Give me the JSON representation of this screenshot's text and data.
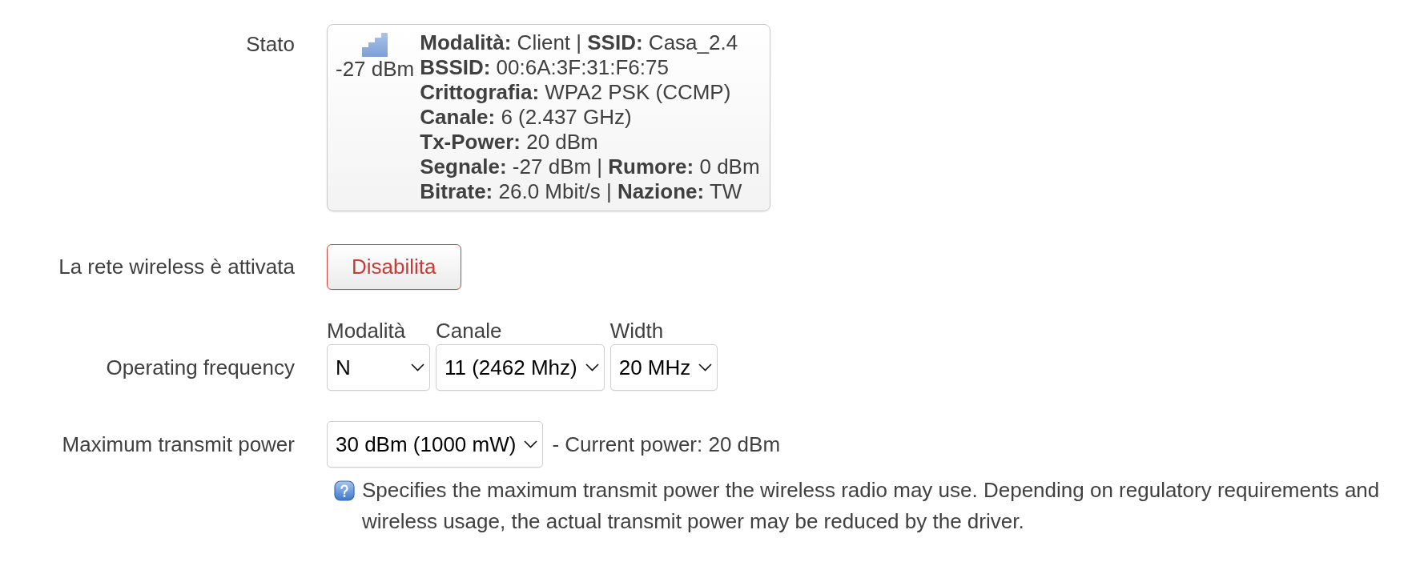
{
  "status": {
    "label": "Stato",
    "signal_reading": "-27 dBm",
    "lines": [
      "**Modalità:** Client | **SSID:** Casa_2.4",
      "**BSSID:** 00:6A:3F:31:F6:75",
      "**Crittografia:** WPA2 PSK (CCMP)",
      "**Canale:** 6 (2.437 GHz)",
      "**Tx-Power:** 20 dBm",
      "**Segnale:** -27 dBm | **Rumore:** 0 dBm",
      "**Bitrate:** 26.0 Mbit/s | **Nazione:** TW"
    ]
  },
  "wireless_toggle": {
    "label": "La rete wireless è attivata",
    "button": "Disabilita"
  },
  "operating_frequency": {
    "label": "Operating frequency",
    "selects": [
      {
        "label": "Modalità",
        "value": "N"
      },
      {
        "label": "Canale",
        "value": "11 (2462 Mhz)"
      },
      {
        "label": "Width",
        "value": "20 MHz"
      }
    ]
  },
  "max_transmit_power": {
    "label": "Maximum transmit power",
    "select": {
      "value": "30 dBm (1000 mW)"
    },
    "note": "- Current power: 20 dBm",
    "help": "Specifies the maximum transmit power the wireless radio may use. Depending on regulatory requirements and wireless usage, the actual transmit power may be reduced by the driver."
  }
}
